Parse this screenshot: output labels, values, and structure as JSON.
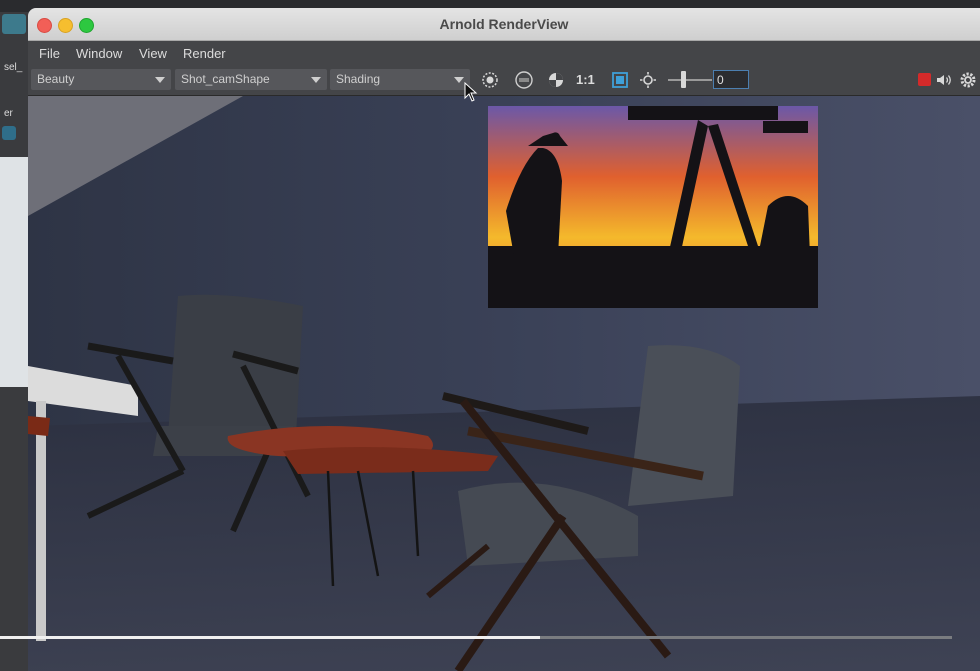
{
  "window": {
    "title": "Arnold RenderView"
  },
  "menu": [
    "File",
    "Window",
    "View",
    "Render"
  ],
  "toolbar": {
    "aov": "Beauty",
    "camera": "Shot_camShape",
    "debug_mode": "Shading",
    "ratio_label": "1:1",
    "exposure_value": "0"
  },
  "background": {
    "left_label_1": "sel_",
    "left_label_2": "er"
  },
  "render_progress": 0.58,
  "colors": {
    "accent_red": "#d42a2a",
    "field_border": "#4c7fb0"
  },
  "icons": [
    "crosshair-icon",
    "rgb-icon",
    "checker-icon",
    "region-icon",
    "sun-icon",
    "record-icon",
    "speaker-icon",
    "gear-icon"
  ]
}
